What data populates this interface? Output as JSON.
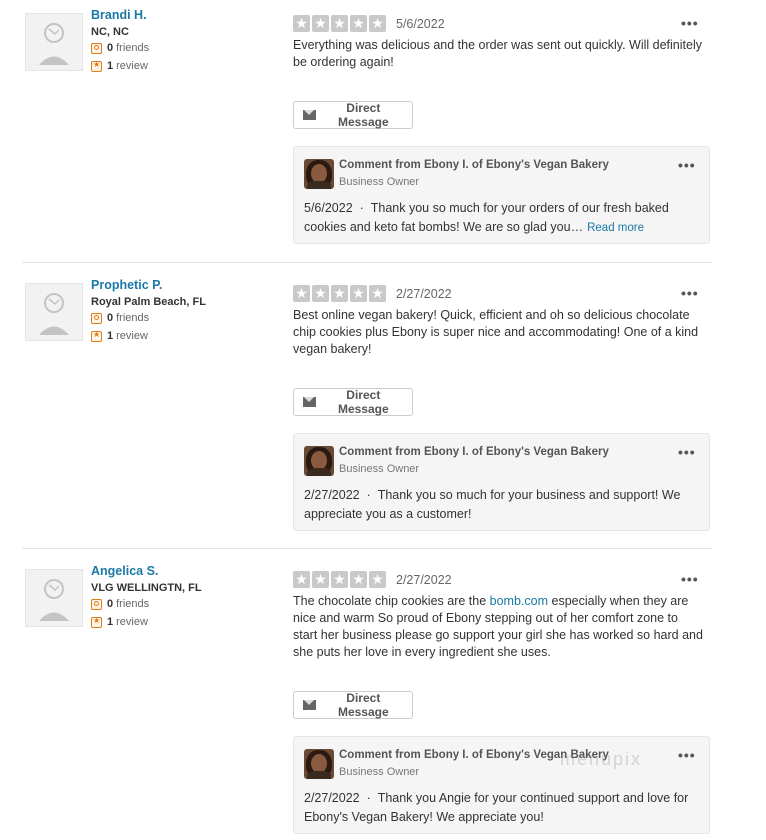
{
  "reviews": [
    {
      "user": {
        "name": "Brandi H.",
        "location": "NC, NC",
        "friends_count": "0",
        "friends_label": "friends",
        "reviews_count": "1",
        "reviews_label": "review"
      },
      "date": "5/6/2022",
      "text": "Everything was delicious and the order was sent out quickly. Will definitely be ordering again!",
      "direct_message_label": "Direct Message",
      "comment": {
        "header": "Comment from Ebony I. of Ebony's Vegan Bakery",
        "role": "Business Owner",
        "date": "5/6/2022",
        "separator": "·",
        "text": "Thank you so much for your orders of our fresh baked cookies and keto fat bombs! We are so glad you…",
        "read_more": "Read more"
      }
    },
    {
      "user": {
        "name": "Prophetic P.",
        "location": "Royal Palm Beach, FL",
        "friends_count": "0",
        "friends_label": "friends",
        "reviews_count": "1",
        "reviews_label": "review"
      },
      "date": "2/27/2022",
      "text": "Best online vegan bakery! Quick, efficient and oh so delicious chocolate chip cookies plus Ebony is super nice and accommodating! One of a kind vegan bakery!",
      "direct_message_label": "Direct Message",
      "comment": {
        "header": "Comment from Ebony I. of Ebony's Vegan Bakery",
        "role": "Business Owner",
        "date": "2/27/2022",
        "separator": "·",
        "text": "Thank you so much for your business and support! We appreciate you as a customer!"
      }
    },
    {
      "user": {
        "name": "Angelica S.",
        "location": "VLG WELLINGTN, FL",
        "friends_count": "0",
        "friends_label": "friends",
        "reviews_count": "1",
        "reviews_label": "review"
      },
      "date": "2/27/2022",
      "text_before_link": "The chocolate chip cookies are the ",
      "link_text": "bomb.com",
      "text_after_link": " especially when they are nice and warm So proud of Ebony stepping out of her comfort zone to start her business please go support your girl she has worked so hard and she puts her love in every ingredient she uses.",
      "direct_message_label": "Direct Message",
      "comment": {
        "header": "Comment from Ebony I. of Ebony's Vegan Bakery",
        "role": "Business Owner",
        "date": "2/27/2022",
        "separator": "·",
        "text": "Thank you Angie for your continued support and love for Ebony's Vegan Bakery! We appreciate you!"
      }
    }
  ],
  "more_glyph": "•••",
  "star_glyph": "★",
  "watermark": "menupix",
  "colors": {
    "link": "#1a79a8",
    "star_empty": "#c9c9c9",
    "stat_icon": "#e07b1a"
  },
  "icons": {
    "avatar": "default-user-icon",
    "friends": "friends-icon",
    "review": "review-star-icon",
    "message": "envelope-icon",
    "more": "more-options-icon"
  }
}
